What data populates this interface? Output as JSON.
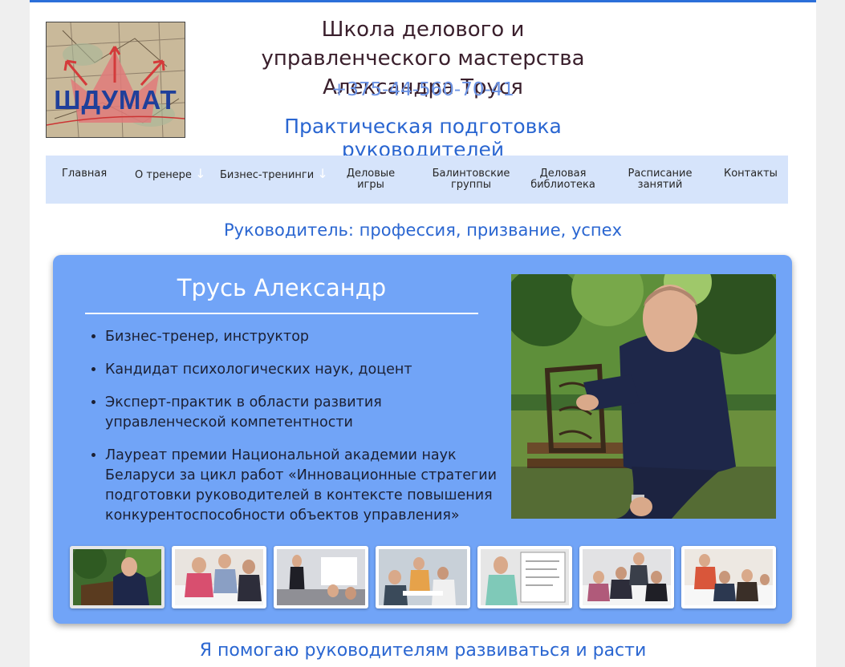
{
  "header": {
    "logo_text": "ШДУМАТ",
    "title_line1": "Школа делового и управленческого мастерства",
    "title_line2": "Александра Труся",
    "phone": "+375-44-560-70-41",
    "tagline": "Практическая подготовка руководителей"
  },
  "nav": {
    "items": [
      {
        "label": "Главная"
      },
      {
        "label": "О тренере"
      },
      {
        "label": "Бизнес-тренинги"
      },
      {
        "label_l1": "Деловые",
        "label_l2": "игры"
      },
      {
        "label_l1": "Балинтовские",
        "label_l2": "группы"
      },
      {
        "label_l1": "Деловая",
        "label_l2": "библиотека"
      },
      {
        "label_l1": "Расписание",
        "label_l2": "занятий"
      },
      {
        "label": "Контакты"
      }
    ],
    "dropdown_icon": "↓"
  },
  "headline": "Руководитель: профессия, призвание, успех",
  "profile": {
    "name": "Трусь Александр",
    "bullets": [
      "Бизнес-тренер, инструктор",
      "Кандидат психологических наук, доцент",
      "Эксперт-практик в области развития управленческой компетентности",
      "Лауреат премии Национальной академии наук Беларуси за цикл работ «Инновационные стратегии подготовки руководителей в контексте повышения конкурентоспособности объектов управления»"
    ]
  },
  "bottom_text": "Я помогаю руководителям развиваться и расти",
  "colors": {
    "accent": "#2a66d1",
    "nav_bg": "#d6e4fb",
    "card_bg": "#71a4f7"
  }
}
